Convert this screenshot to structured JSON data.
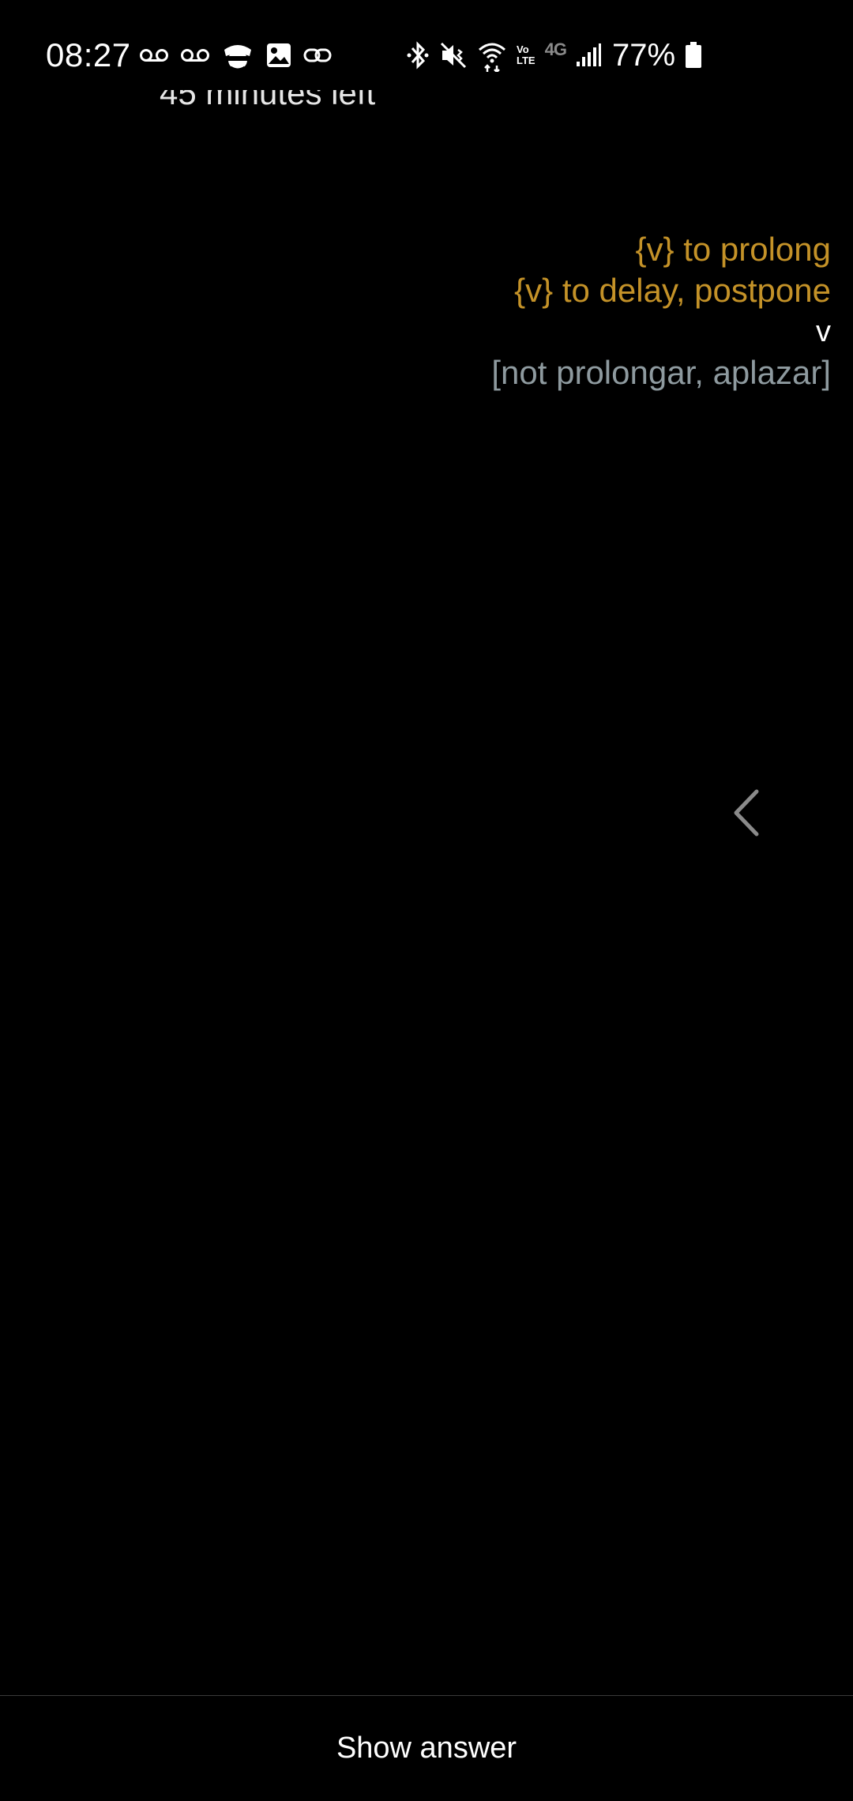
{
  "status_bar": {
    "time": "08:27",
    "volte_top": "Vo",
    "volte_bottom": "LTE",
    "network_type": "4G",
    "battery_percent": "77%",
    "icons_left": [
      "voicemail-icon",
      "voicemail-icon",
      "app-notification-icon",
      "image-icon",
      "link-icon"
    ],
    "icons_right": [
      "bluetooth-icon",
      "vibrate-mute-icon",
      "wifi-icon",
      "volte-icon",
      "network-4g-icon",
      "signal-icon",
      "battery-icon"
    ]
  },
  "session": {
    "time_left": "45 minutes left"
  },
  "card": {
    "line1": "{v} to prolong",
    "line2": "{v} to delay, postpone",
    "part_of_speech": "v",
    "note": "[not prolongar, aplazar]"
  },
  "actions": {
    "show_answer_label": "Show answer"
  },
  "colors": {
    "background": "#000000",
    "accent": "#c49228",
    "note": "#8e9a9f",
    "text": "#ffffff"
  }
}
